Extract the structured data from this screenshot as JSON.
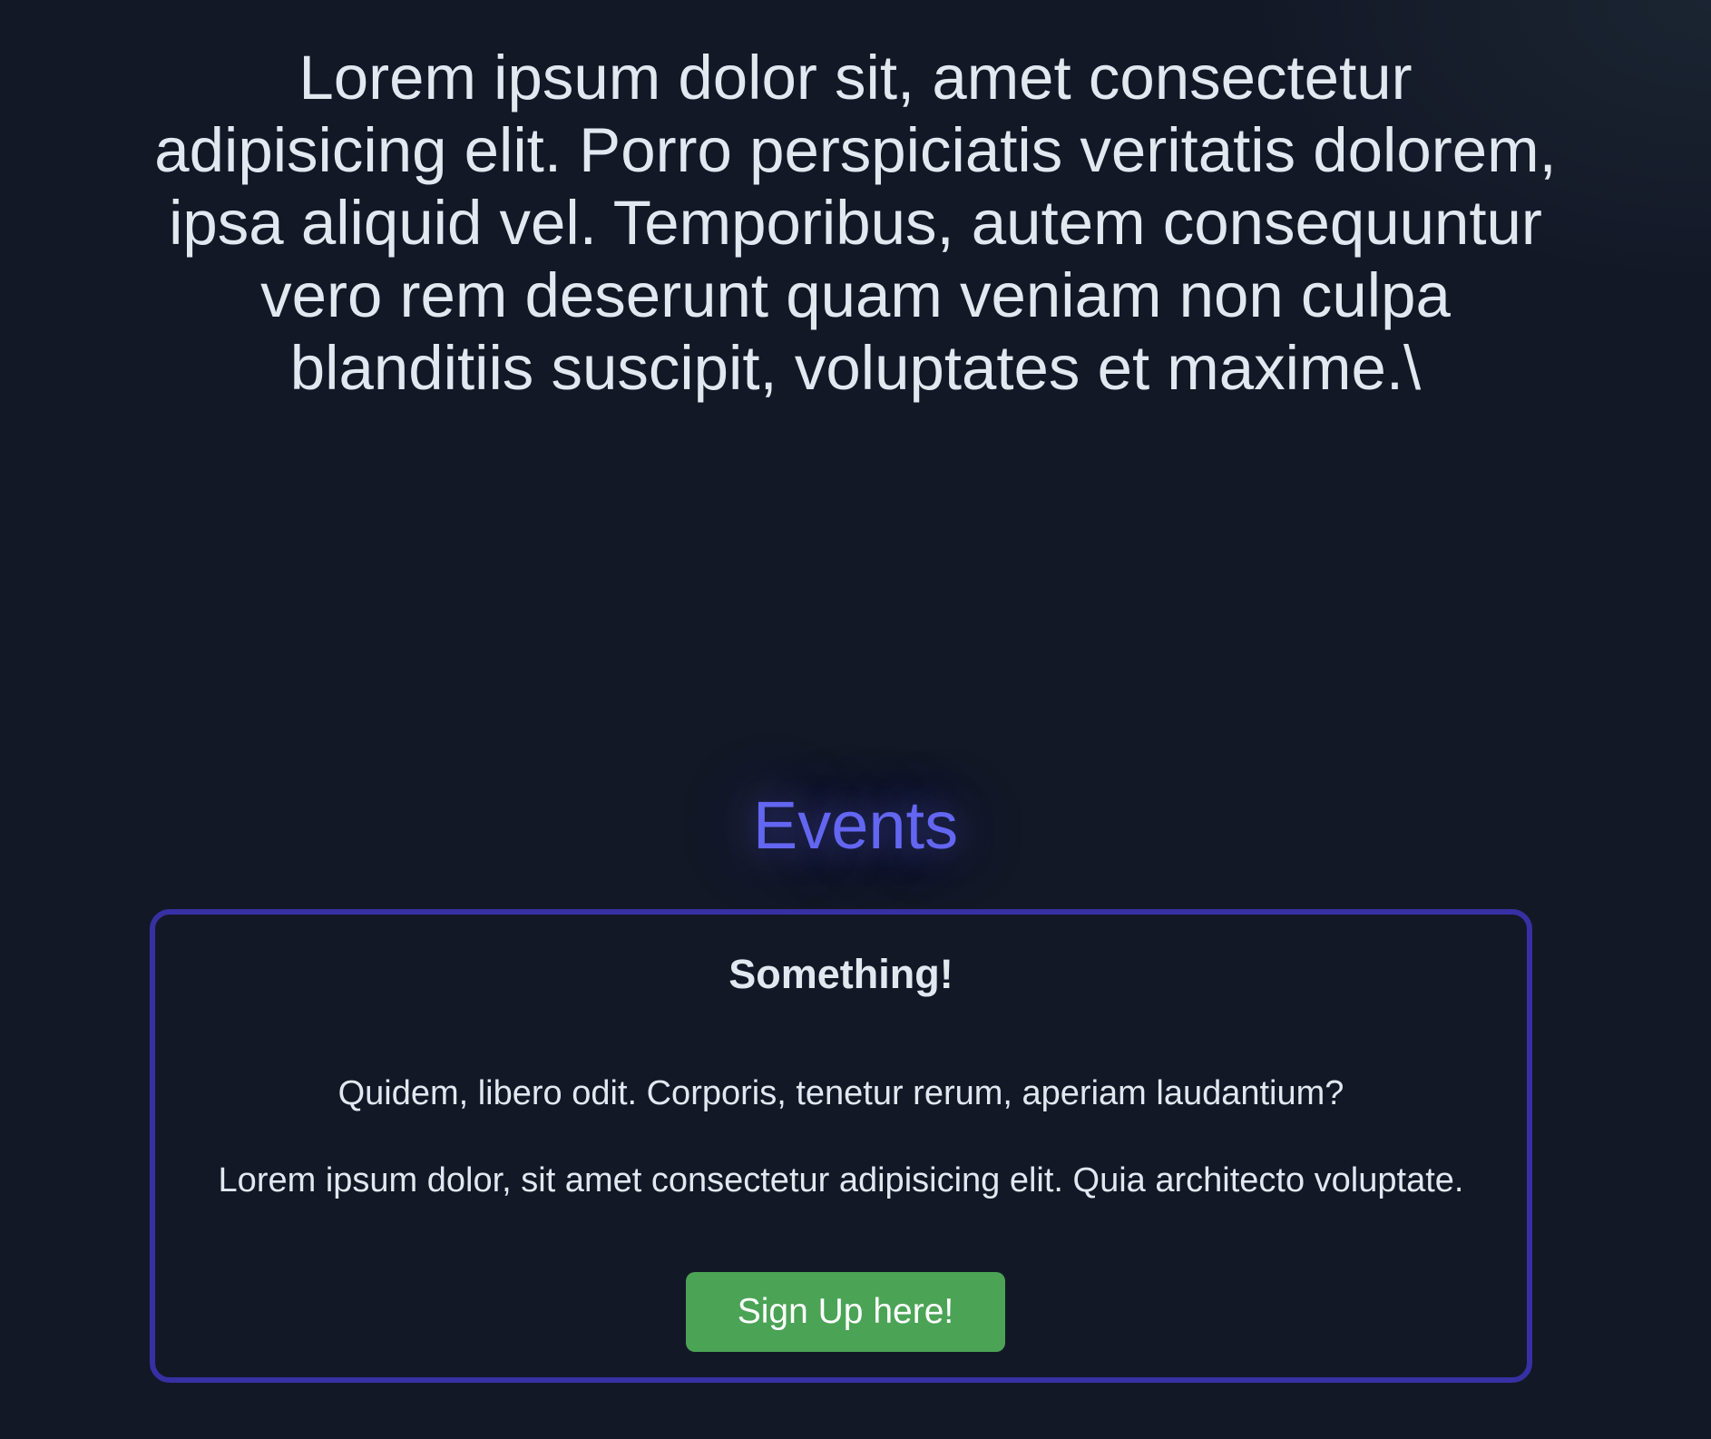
{
  "intro": {
    "text": "Lorem ipsum dolor sit, amet consectetur adipisicing elit. Porro perspiciatis veritatis dolorem, ipsa aliquid vel. Temporibus, autem consequuntur vero rem deserunt quam veniam non culpa blanditiis suscipit, voluptates et maxime.\\"
  },
  "events": {
    "heading": "Events",
    "card": {
      "title": "Something!",
      "line1": "Quidem, libero odit. Corporis, tenetur rerum, aperiam laudantium?",
      "line2": "Lorem ipsum dolor, sit amet consectetur adipisicing elit. Quia architecto voluptate.",
      "button_label": "Sign Up here!"
    }
  },
  "colors": {
    "background": "#131827",
    "text": "#e2e8f0",
    "accent": "#6366f1",
    "card_border": "#3730a3",
    "button": "#4ba356"
  }
}
